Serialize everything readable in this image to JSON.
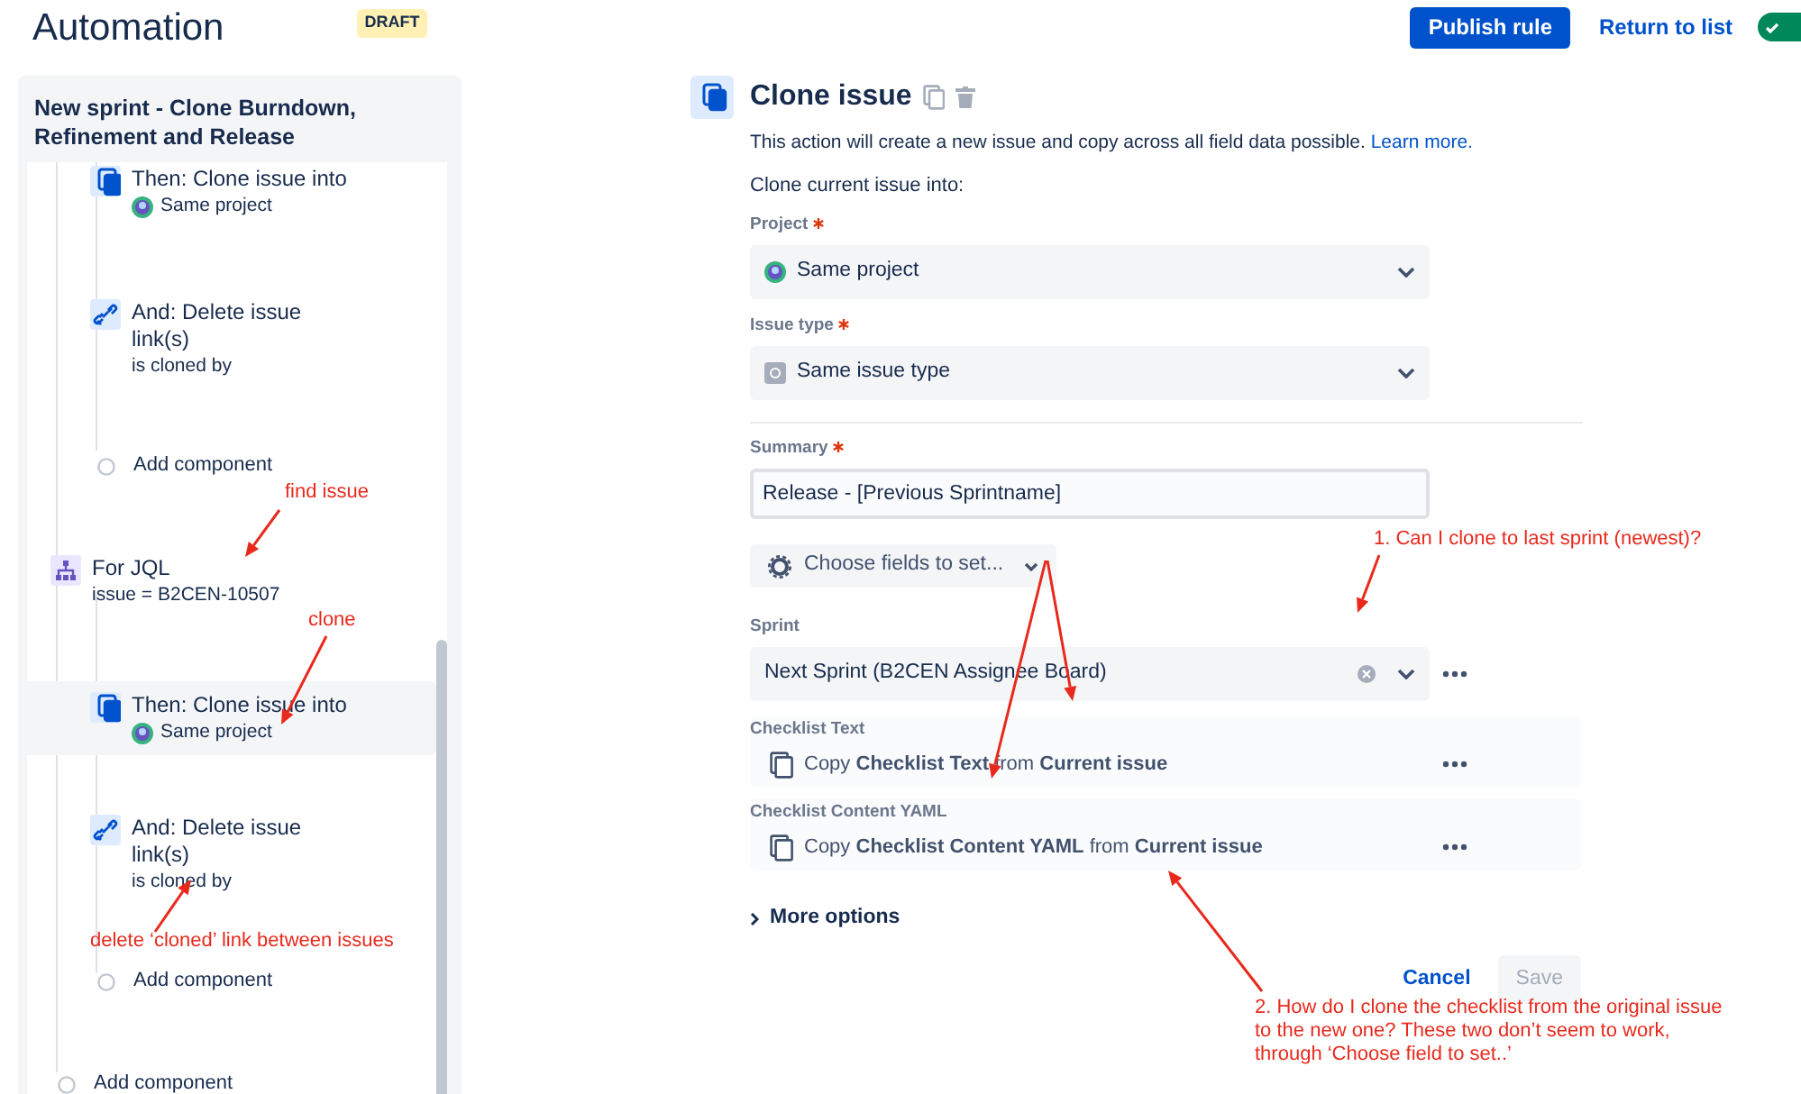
{
  "header": {
    "title": "Automation",
    "badge": "DRAFT",
    "primary_button": "Publish rule",
    "link": "Return to list",
    "toggle": {
      "on": true
    }
  },
  "rule": {
    "title": "New sprint - Clone Burndown, Refinement and Release",
    "components": [
      {
        "kind": "group",
        "children": [
          {
            "kind": "clone",
            "title": "Then: Clone issue into",
            "detail": "Same project",
            "selected": false
          },
          {
            "kind": "delete-link",
            "title": "And: Delete issue link(s)",
            "detail": "is cloned by",
            "selected": false
          },
          {
            "kind": "add",
            "title": "Add component",
            "selected": false
          }
        ]
      },
      {
        "kind": "branch",
        "title": "For JQL",
        "detail": "issue = B2CEN-10507",
        "selected": false,
        "children": [
          {
            "kind": "clone",
            "title": "Then: Clone issue into",
            "detail": "Same project",
            "selected": true
          },
          {
            "kind": "delete-link",
            "title": "And: Delete issue link(s)",
            "detail": "is cloned by",
            "selected": false
          },
          {
            "kind": "add",
            "title": "Add component",
            "selected": false
          }
        ]
      },
      {
        "kind": "add",
        "title": "Add component",
        "selected": false
      }
    ]
  },
  "action": {
    "title": "Clone issue",
    "description": "This action will create a new issue and copy across all field data possible.",
    "learn_more": "Learn more.",
    "intro": "Clone current issue into:",
    "fields": [
      {
        "kind": "select",
        "label": "Project",
        "required": true,
        "value": "Same project"
      },
      {
        "kind": "select",
        "label": "Issue type",
        "required": true,
        "value": "Same issue type"
      },
      {
        "kind": "text",
        "label": "Summary",
        "required": true,
        "value": "Release - [Previous Sprintname]",
        "separated": true
      },
      {
        "kind": "chooser",
        "label": "Choose fields to set..."
      },
      {
        "kind": "select",
        "label": "Sprint",
        "value": "Next Sprint (B2CEN Assignee Board)",
        "clearable": true
      },
      {
        "kind": "copy",
        "label": "Checklist Text",
        "value": "Copy **Checklist Text** from **Current issue**"
      },
      {
        "kind": "copy",
        "label": "Checklist Content YAML",
        "value": "Copy **Checklist Content YAML** from **Current issue**"
      }
    ],
    "more_options": "More options",
    "cancel": "Cancel",
    "save": {
      "label": "Save",
      "disabled": true
    }
  },
  "annotations": [
    {
      "text": "find issue"
    },
    {
      "text": "clone"
    },
    {
      "text": "delete ‘cloned’ link between issues"
    },
    {
      "text": "1. Can I clone to last sprint (newest)?"
    },
    {
      "text": "2. How do I clone the checklist from the original issue to the new one? These two don’t seem to work, through ‘Choose field to set..’"
    }
  ]
}
